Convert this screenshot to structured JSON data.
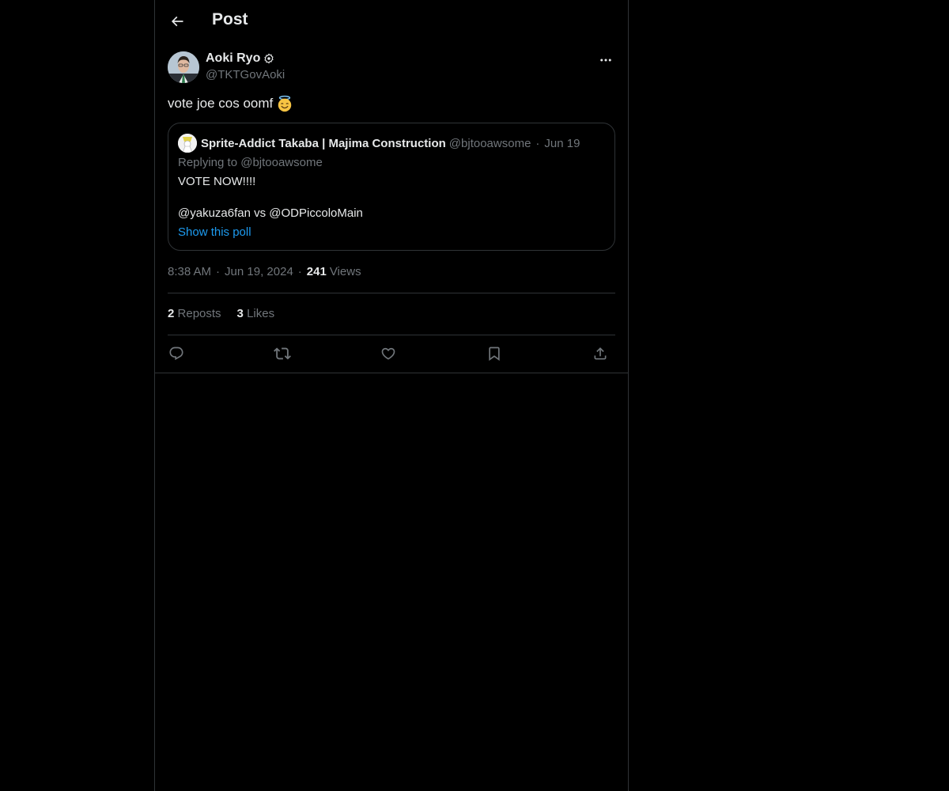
{
  "header": {
    "title": "Post",
    "back_icon": "arrow-left-icon"
  },
  "post": {
    "author": {
      "name": "Aoki Ryo",
      "handle": "@TKTGovAoki",
      "badge_icon": "verified-badge-icon"
    },
    "text": "vote joe cos oomf",
    "emoji_icon": "smiling-face-with-halo-emoji",
    "time": "8:38 AM",
    "date": "Jun 19, 2024",
    "views": {
      "count": "241",
      "label": "Views"
    },
    "separator": "·"
  },
  "quote": {
    "author_name": "Sprite-Addict Takaba | Majima Construction",
    "author_handle": "@bjtooawsome",
    "date": "Jun 19",
    "replying_to": "Replying to @bjtooawsome",
    "line1": "VOTE NOW!!!!",
    "line2": "@yakuza6fan vs @ODPiccoloMain",
    "poll_link": "Show this poll"
  },
  "stats": {
    "reposts_count": "2",
    "reposts_label": "Reposts",
    "likes_count": "3",
    "likes_label": "Likes"
  },
  "actions": [
    "reply-icon",
    "repost-icon",
    "like-icon",
    "bookmark-icon",
    "share-icon"
  ],
  "colors": {
    "background": "#000000",
    "text": "#e7e9ea",
    "secondary": "#71767b",
    "border": "#2f3336",
    "link": "#1d9bf0"
  }
}
